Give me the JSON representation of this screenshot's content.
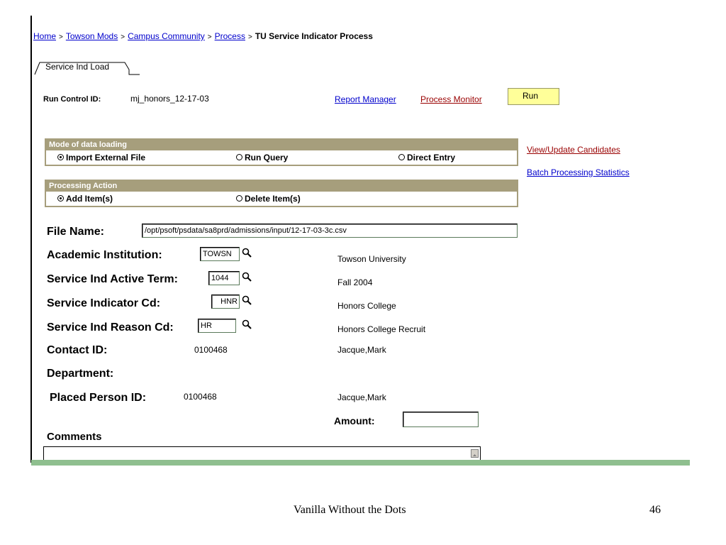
{
  "breadcrumb": {
    "items": [
      "Home",
      "Towson Mods",
      "Campus Community",
      "Process"
    ],
    "current": "TU Service Indicator Process",
    "separator": ">"
  },
  "tab": {
    "label": "Service Ind Load"
  },
  "run_control": {
    "label": "Run Control ID:",
    "value": "mj_honors_12-17-03",
    "report_manager": "Report Manager",
    "process_monitor": "Process Monitor",
    "run_button": "Run"
  },
  "side_links": {
    "view_update": "View/Update Candidates",
    "batch_stats": "Batch Processing Statistics"
  },
  "mode_panel": {
    "title": "Mode of data loading",
    "options": [
      "Import External File",
      "Run Query",
      "Direct Entry"
    ],
    "selected": "Import External File"
  },
  "action_panel": {
    "title": "Processing Action",
    "options": [
      "Add Item(s)",
      "Delete Item(s)"
    ],
    "selected": "Add Item(s)"
  },
  "form": {
    "file_name_label": "File Name:",
    "file_name_value": "/opt/psoft/psdata/sa8prd/admissions/input/12-17-03-3c.csv",
    "institution_label": "Academic Institution:",
    "institution_value": "TOWSN",
    "institution_desc": "Towson University",
    "term_label": "Service Ind Active Term:",
    "term_value": "1044",
    "term_desc": "Fall 2004",
    "indicator_label": "Service Indicator Cd:",
    "indicator_value": "HNR",
    "indicator_desc": "Honors College",
    "reason_label": "Service Ind Reason Cd:",
    "reason_value": "HR",
    "reason_desc": "Honors College Recruit",
    "contact_label": "Contact ID:",
    "contact_value": "0100468",
    "contact_name": "Jacque,Mark",
    "department_label": "Department:",
    "placed_label": "Placed Person ID:",
    "placed_value": "0100468",
    "placed_name": "Jacque,Mark",
    "amount_label": "Amount:",
    "amount_value": "",
    "comments_label": "Comments"
  },
  "footer": {
    "title": "Vanilla Without the Dots",
    "page": "46"
  },
  "colors": {
    "panel_header": "#a69e7c",
    "link": "#0000cc",
    "link_alt": "#990000",
    "run_button": "#ffff99",
    "rule": "#8fbf8f"
  }
}
